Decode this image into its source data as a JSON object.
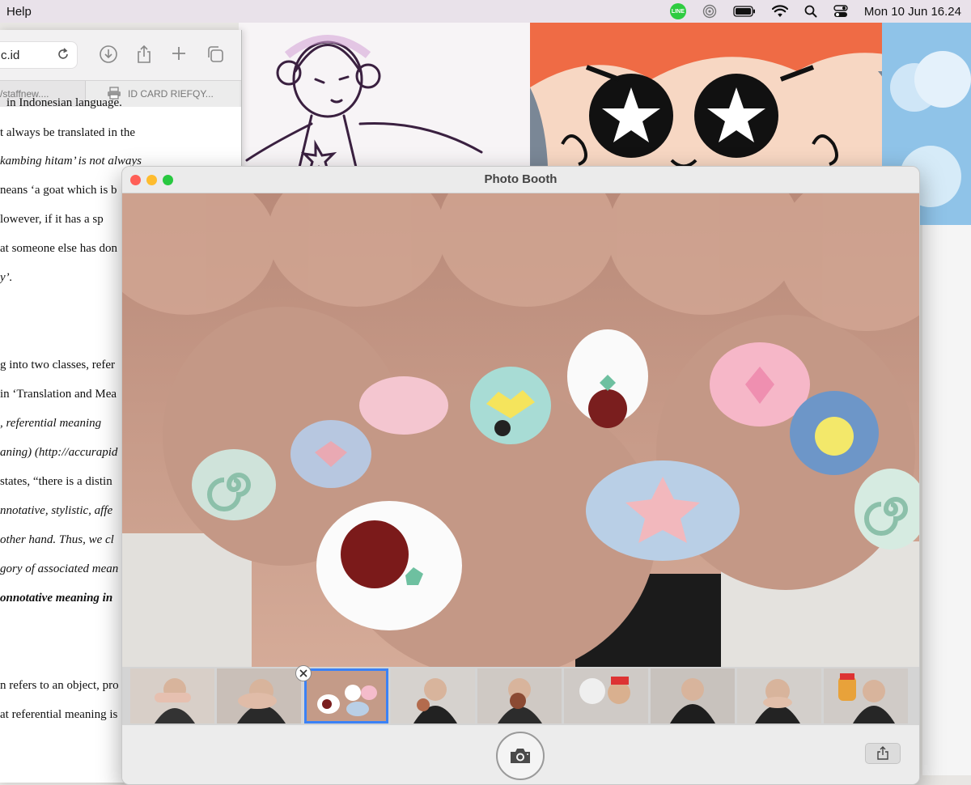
{
  "menubar": {
    "help_label": "Help",
    "line_badge": "LINE",
    "clock": "Mon 10 Jun  16.24",
    "icons": [
      "line-icon",
      "airdrop-icon",
      "battery-icon",
      "wifi-icon",
      "search-icon",
      "control-center-icon"
    ]
  },
  "browser": {
    "address": "c.id",
    "tabs": [
      {
        "label": "/staffnew...."
      },
      {
        "label": "ID CARD RIEFQY..."
      }
    ],
    "lines": [
      "in Indonesian language.",
      "t always be translated in the",
      "kambing hitam’ is not always",
      "neans ‘a goat which is b",
      "lowever, if it has a sp",
      "at someone else has don",
      "y’.",
      "g into two classes, refer",
      "in ‘Translation and Mea",
      ", referential meaning",
      "aning) (http://accurapid",
      "states, “there is a distin",
      "nnotative, stylistic, affe",
      "other hand. Thus, we cl",
      "gory of associated mean",
      "onnotative meaning in",
      "n refers to an object, pro",
      "at referential meaning is"
    ]
  },
  "photobooth": {
    "title": "Photo Booth",
    "thumbnails": [
      {
        "label": "photo 1"
      },
      {
        "label": "photo 2"
      },
      {
        "label": "photo 3"
      },
      {
        "label": "photo 4"
      },
      {
        "label": "photo 5"
      },
      {
        "label": "photo 6"
      },
      {
        "label": "photo 7"
      },
      {
        "label": "photo 8"
      },
      {
        "label": "photo 9"
      }
    ],
    "selected_thumbnail": 3
  }
}
